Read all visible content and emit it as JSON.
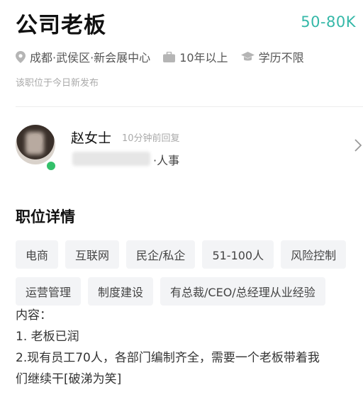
{
  "job": {
    "title": "公司老板",
    "salary": "50-80K",
    "location": "成都·武侯区·新会展中心",
    "experience": "10年以上",
    "education": "学历不限",
    "posted": "该职位于今日新发布"
  },
  "recruiter": {
    "name": "赵女士",
    "reply_status": "10分钟前回复",
    "role": "·人事",
    "online_color": "#33c06a"
  },
  "details": {
    "section_title": "职位详情",
    "tags_row1": [
      "电商",
      "互联网",
      "民企/私企",
      "51-100人",
      "风险控制"
    ],
    "tags_row2": [
      "运营管理",
      "制度建设",
      "有总裁/CEO/总经理从业经验"
    ],
    "description": [
      "内容：",
      "1. 老板已润",
      "2.现有员工70人，各部门编制齐全，需要一个老板带着我",
      "们继续干[破涕为笑]"
    ]
  },
  "colors": {
    "salary": "#35b8a8"
  },
  "icons": {
    "location": "location-pin-icon",
    "experience": "briefcase-icon",
    "education": "graduation-cap-icon",
    "navigate": "chevron-right-icon"
  }
}
